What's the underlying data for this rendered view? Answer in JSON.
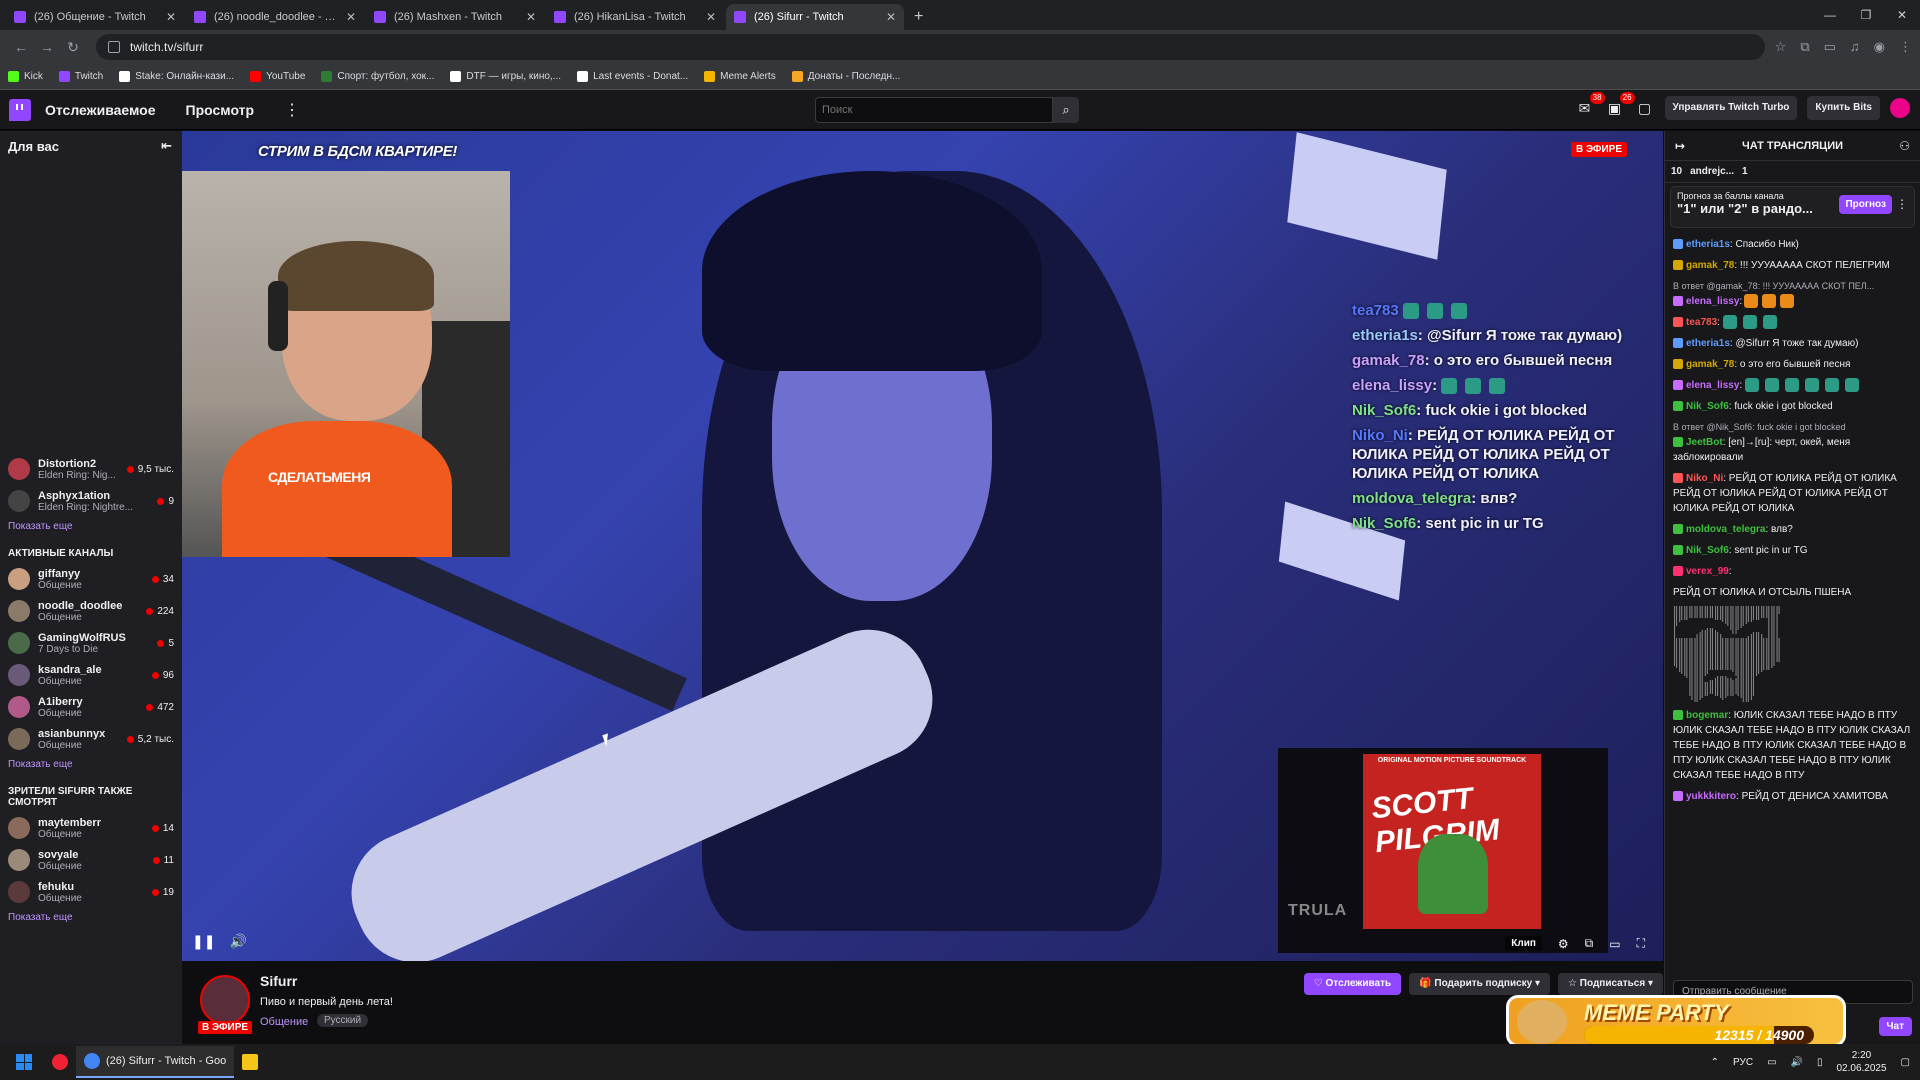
{
  "browser": {
    "tabs": [
      {
        "title": "(26) Общение - Twitch",
        "active": false
      },
      {
        "title": "(26) noodle_doodlee - Twitch",
        "active": false
      },
      {
        "title": "(26) Mashxen - Twitch",
        "active": false
      },
      {
        "title": "(26) HikanLisa - Twitch",
        "active": false
      },
      {
        "title": "(26) Sifurr - Twitch",
        "active": true
      }
    ],
    "url": "twitch.tv/sifurr",
    "bookmarks": [
      {
        "label": "Kick",
        "color": "#53fc18"
      },
      {
        "label": "Twitch",
        "color": "#9147ff"
      },
      {
        "label": "Stake: Онлайн-кази...",
        "color": "#ffffff"
      },
      {
        "label": "YouTube",
        "color": "#ff0000"
      },
      {
        "label": "Спорт: футбол, хок...",
        "color": "#2e7d32"
      },
      {
        "label": "DTF — игры, кино,...",
        "color": "#ffffff"
      },
      {
        "label": "Last events - Donat...",
        "color": "#ffffff"
      },
      {
        "label": "Meme Alerts",
        "color": "#f5b400"
      },
      {
        "label": "Донаты - Последн...",
        "color": "#f5a623"
      }
    ]
  },
  "twitch_nav": {
    "following": "Отслеживаемое",
    "browse": "Просмотр",
    "search_placeholder": "Поиск",
    "notif_count_1": "38",
    "notif_count_2": "26",
    "turbo_button": "Управлять Twitch Turbo",
    "bits_button": "Купить Bits"
  },
  "sidebar": {
    "title": "Для вас",
    "followed": [
      {
        "name": "Distortion2",
        "game": "Elden Ring: Nig...",
        "viewers": "9,5 тыс.",
        "color": "#b03a48"
      },
      {
        "name": "Asphyx1ation",
        "game": "Elden Ring: Nightre...",
        "viewers": "9",
        "color": "#444"
      }
    ],
    "show_more": "Показать еще",
    "active_title": "АКТИВНЫЕ КАНАЛЫ",
    "active": [
      {
        "name": "giffanyy",
        "game": "Общение",
        "viewers": "34",
        "color": "#c8a080"
      },
      {
        "name": "noodle_doodlee",
        "game": "Общение",
        "viewers": "224",
        "color": "#8a7a6a"
      },
      {
        "name": "GamingWolfRUS",
        "game": "7 Days to Die",
        "viewers": "5",
        "color": "#4a6a4a"
      },
      {
        "name": "ksandra_ale",
        "game": "Общение",
        "viewers": "96",
        "color": "#6a5a7a"
      },
      {
        "name": "A1iberry",
        "game": "Общение",
        "viewers": "472",
        "color": "#b05a8a"
      },
      {
        "name": "asianbunnyx",
        "game": "Общение",
        "viewers": "5,2 тыс.",
        "color": "#7a6a5a"
      }
    ],
    "show_more_2": "Показать еще",
    "also_title": "ЗРИТЕЛИ SIFURR ТАКЖЕ СМОТРЯТ",
    "also": [
      {
        "name": "maytemberr",
        "game": "Общение",
        "viewers": "14",
        "color": "#8a6a5a"
      },
      {
        "name": "sovyale",
        "game": "Общение",
        "viewers": "11",
        "color": "#9a8a7a"
      },
      {
        "name": "fehuku",
        "game": "Общение",
        "viewers": "19",
        "color": "#5a3a3a"
      }
    ],
    "show_more_3": "Показать еще"
  },
  "stream": {
    "banner": "СТРИМ В БДСМ КВАРТИРЕ!",
    "live_badge": "В ЭФИРЕ",
    "cam_shirt_text": "СДЕЛАТЬМЕНЯ",
    "overlay_chat": [
      {
        "user": "tea783",
        "cls": "u",
        "text": ""
      },
      {
        "user": "etheria1s",
        "cls": "u g",
        "text": ": @Sifurr Я тоже так думаю)"
      },
      {
        "user": "gamak_78",
        "cls": "u o",
        "text": ": о это его бывшей песня"
      },
      {
        "user": "elena_lissy",
        "cls": "u y",
        "text": ":"
      },
      {
        "user": "Nik_Sof6",
        "cls": "u gr",
        "text": ": fuck okie i got blocked"
      },
      {
        "user": "Niko_Ni",
        "cls": "u",
        "text": ": РЕЙД ОТ ЮЛИКА РЕЙД ОТ ЮЛИКА РЕЙД ОТ ЮЛИКА РЕЙД ОТ ЮЛИКА РЕЙД ОТ ЮЛИКА"
      },
      {
        "user": "moldova_telegra",
        "cls": "u gr",
        "text": ": влв?"
      },
      {
        "user": "Nik_Sof6",
        "cls": "u gr",
        "text": ": sent pic in ur TG"
      }
    ],
    "album_top": "ORIGINAL MOTION PICTURE SOUNDTRACK",
    "album_title": "SCOTT PILGRIM",
    "album_watermark": "TRULA",
    "clip": "Клип"
  },
  "channel": {
    "name": "Sifurr",
    "title": "Пиво и первый день лета!",
    "category": "Общение",
    "tag": "Русский",
    "live": "В ЭФИРЕ",
    "follow": "Отслеживать",
    "gift": "Подарить подписку",
    "subscribe": "Подписаться"
  },
  "chat": {
    "header": "ЧАТ ТРАНСЛЯЦИИ",
    "hype_count": "10",
    "hype_user": "andrejc...",
    "hype_gift": "1",
    "pred_label": "Прогноз за баллы канала",
    "pred_question": "\"1\" или \"2\" в рандо...",
    "pred_button": "Прогноз",
    "messages": [
      {
        "user": "etheria1s",
        "color": "#5e9cff",
        "text": ": Спасибо Ник)"
      },
      {
        "user": "gamak_78",
        "color": "#d4a800",
        "text": ": !!! УУУААААА СКОТ ПЕЛЕГРИМ"
      },
      {
        "reply": "В ответ @gamak_78: !!! УУУААААА СКОТ ПЕЛ...",
        "user": "elena_lissy",
        "color": "#c86cff",
        "text": ":",
        "emotes": "orange3"
      },
      {
        "user": "tea783",
        "color": "#ff5555",
        "text": ":",
        "emotes": "green3"
      },
      {
        "user": "etheria1s",
        "color": "#5e9cff",
        "text": ": @Sifurr Я тоже так думаю)"
      },
      {
        "user": "gamak_78",
        "color": "#d4a800",
        "text": ": о это его бывшей песня"
      },
      {
        "user": "elena_lissy",
        "color": "#c86cff",
        "text": ":",
        "emotes": "green6"
      },
      {
        "user": "Nik_Sof6",
        "color": "#3fbf3f",
        "text": ": fuck okie i got blocked"
      },
      {
        "reply": "В ответ @Nik_Sof6: fuck okie i got blocked",
        "user": "JeetBot",
        "color": "#3fbf3f",
        "text": ": [en]→[ru]: черт, окей, меня заблокировали"
      },
      {
        "user": "Niko_Ni",
        "color": "#ff5555",
        "text": ": РЕЙД ОТ ЮЛИКА РЕЙД ОТ ЮЛИКА РЕЙД ОТ ЮЛИКА РЕЙД ОТ ЮЛИКА РЕЙД ОТ ЮЛИКА РЕЙД ОТ ЮЛИКА"
      },
      {
        "user": "moldova_telegra",
        "color": "#3fbf3f",
        "text": ": влв?"
      },
      {
        "user": "Nik_Sof6",
        "color": "#3fbf3f",
        "text": ": sent pic in ur TG"
      },
      {
        "user": "verex_99",
        "color": "#ff3070",
        "text": ":"
      },
      {
        "text_only": "РЕЙД ОТ ЮЛИКА И ОТСЫЛЬ ПШЕНА"
      }
    ],
    "ascii": "⣿⣿⣿⣿⣿⣿⣿⣿⣿⣿⣿⣿⣿⣿⣿⣿⣿⣿⣿⣿⣿\n⣿⡿⠿⠛⠛⠛⠛⠛⠿⢿⣿⣿⣿⣿⣿⡿⠿⠛⢻⣿⡇\n⡟⠀⠀⠀⠀⠀⢀⣀⠀⠀⠙⣿⣿⠟⠁⠀⠀⠀⢸⣿⡇\n⡇⠀⠀⠀⢠⣾⣿⣿⣷⡄⠀⠘⠃⠀⢀⣴⣶⡄⢸⣿⡇\n⣿⣿⣿⣿⣿⣿⣿⣿⣿⣿⣿⣿⣿⣿⣿⣿⣿⣿⣿⣿⣿\n⣿⣿⣿⣿⣿⣿⣿⣿⣿⣿⣿⣿⣿⣿⣿⣿⣿⣿⣿⣿⣿\n⣿⣿⣿⣿⣿⣿⣿⣿⣿⣿⣿⣿⣿⣿⣿⣿⣿⣿⣿⣿⣿\n⠻⣿⣿⣿⣿⣿⣿⣿⣿⣿⣿⣿⣿⣿⣿⣿⣿⣿⣿⠟⠀\n⠀⠙⢿⣿⣿⣿⠟⠀⢀⣀⡀⠈⢿⣿⣿⣿⠟⠁⠀⠀⠀\n⠀⠀⠀⣿⣿⣿⣤⣶⣿⣿⣿⣷⣿⣿⣿⣿⠀⠀⠀⠀⠀\n⠀⠀⠀⣿⣿⣿⣿⣿⣿⣿⣿⣿⣿⣿⣿⣿⠀⠀⠀⠀⠀\n⠀⠀⠀⠹⣿⠟⠉⠀⠉⠻⠋⠉⠈⢻⣿⠏⠀⠀⠀⠀⠀",
    "messages2": [
      {
        "user": "bogemar",
        "color": "#3fbf3f",
        "text": ": ЮЛИК СКАЗАЛ ТЕБЕ НАДО В ПТУ ЮЛИК СКАЗАЛ ТЕБЕ НАДО В ПТУ ЮЛИК СКАЗАЛ ТЕБЕ НАДО В ПТУ ЮЛИК СКАЗАЛ ТЕБЕ НАДО В ПТУ ЮЛИК СКАЗАЛ ТЕБЕ НАДО В ПТУ ЮЛИК СКАЗАЛ ТЕБЕ НАДО В ПТУ"
      },
      {
        "user": "yukkkitero",
        "color": "#c86cff",
        "text": ": РЕЙД ОТ ДЕНИСА ХАМИТОВА"
      }
    ],
    "input_placeholder": "Отправить сообщение",
    "chat_button": "Чат"
  },
  "meme_party": {
    "title": "MEME PARTY",
    "progress_text": "12315 / 14900",
    "current": 12315,
    "goal": 14900
  },
  "taskbar": {
    "active_app": "(26) Sifurr - Twitch - Goo",
    "lang": "РУС",
    "time": "2:20",
    "date": "02.06.2025"
  }
}
